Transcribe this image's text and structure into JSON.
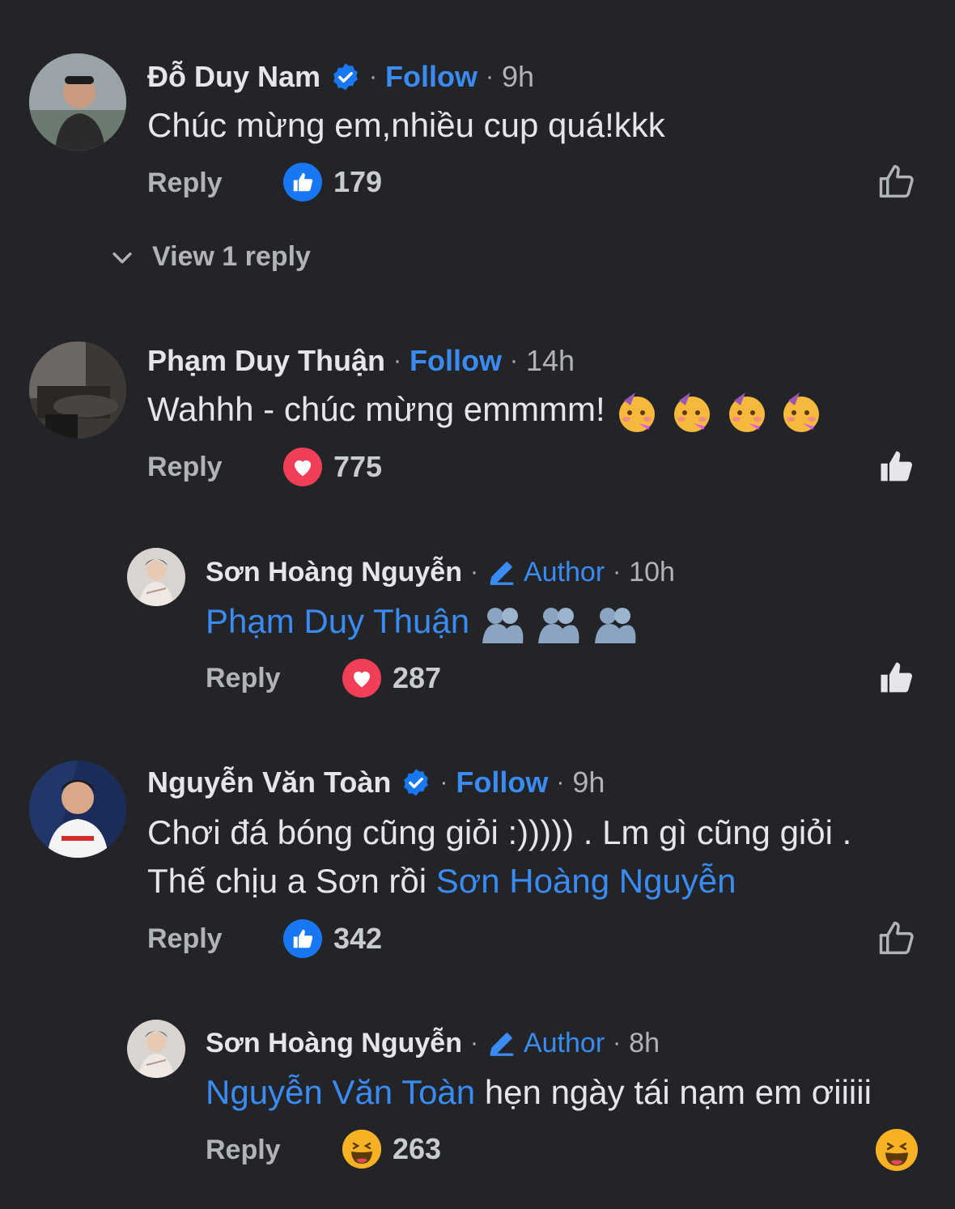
{
  "comments": [
    {
      "name": "Đỗ Duy Nam",
      "verified": true,
      "follow": "Follow",
      "time": "9h",
      "text": "Chúc mừng em,nhiều cup quá!kkk",
      "reply": "Reply",
      "reaction": "like",
      "count": "179",
      "view_replies": "View 1 reply"
    },
    {
      "name": "Phạm Duy Thuận",
      "follow": "Follow",
      "time": "14h",
      "text": "Wahhh - chúc mừng emmmm!",
      "reply": "Reply",
      "reaction": "love",
      "count": "775"
    },
    {
      "name": "Sơn Hoàng Nguyễn",
      "author": "Author",
      "time": "10h",
      "mention": "Phạm Duy Thuận",
      "reply": "Reply",
      "reaction": "love",
      "count": "287"
    },
    {
      "name": "Nguyễn Văn Toàn",
      "verified": true,
      "follow": "Follow",
      "time": "9h",
      "text_line1": "Chơi đá bóng cũng giỏi :))))) . Lm gì cũng giỏi .",
      "text_line2": "Thế chịu a Sơn rồi ",
      "mention": "Sơn Hoàng Nguyễn",
      "reply": "Reply",
      "reaction": "like",
      "count": "342"
    },
    {
      "name": "Sơn Hoàng Nguyễn",
      "author": "Author",
      "time": "8h",
      "mention": "Nguyễn Văn Toàn",
      "text": " hẹn ngày tái nạm em ơiiiii",
      "reply": "Reply",
      "reaction": "haha",
      "count": "263"
    }
  ],
  "colors": {
    "background": "#232427",
    "accent": "#3a8bf4",
    "love": "#f33e58",
    "haha": "#f7b125"
  }
}
